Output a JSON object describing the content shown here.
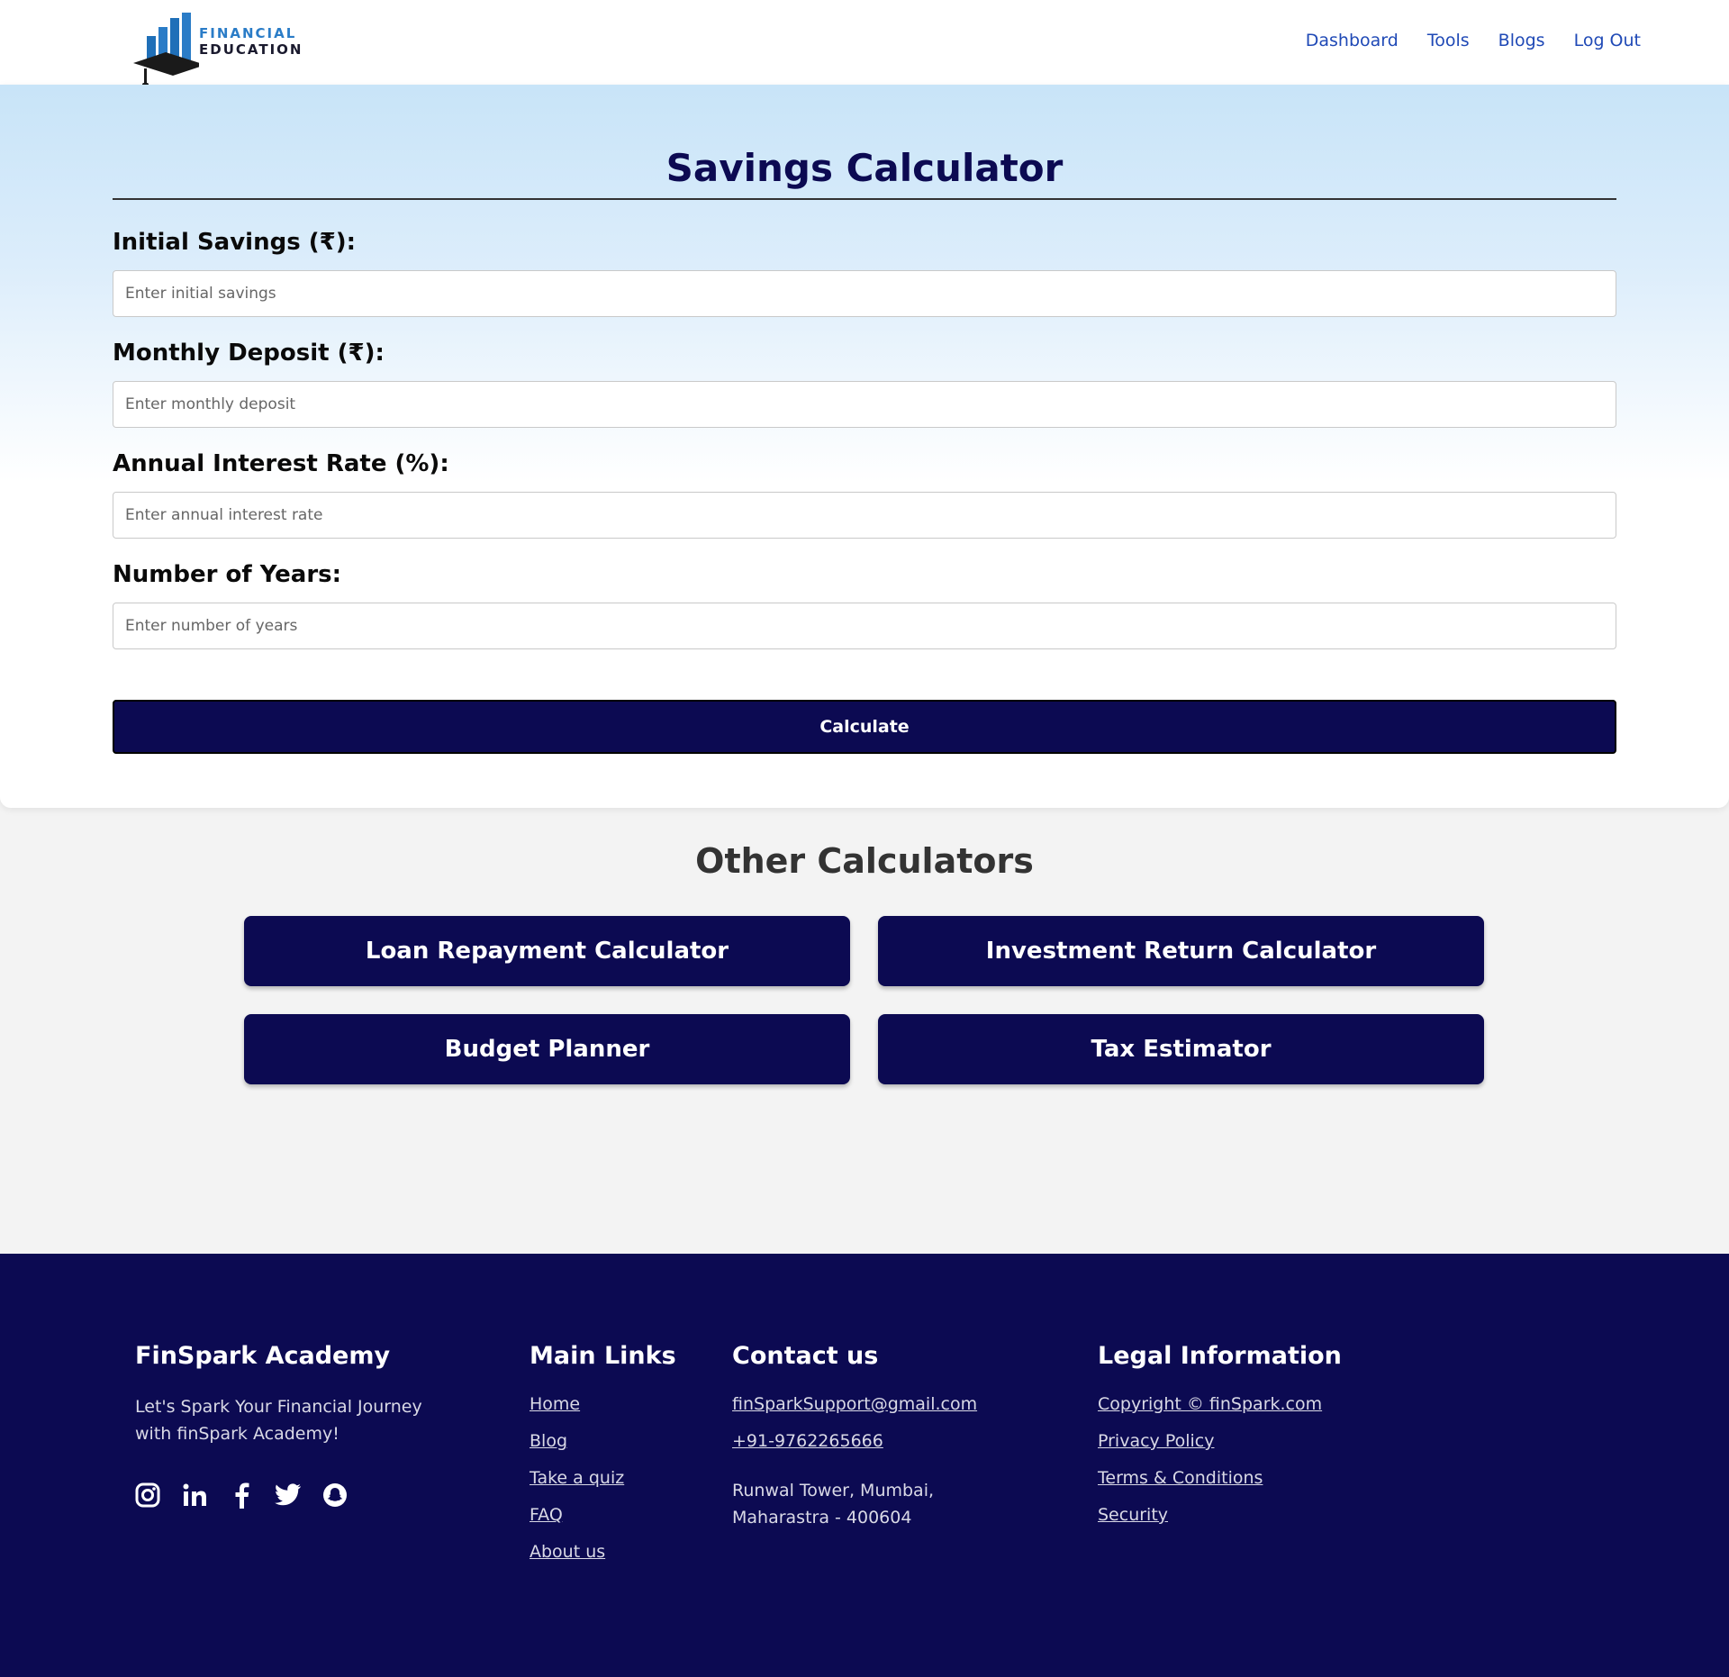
{
  "header": {
    "logo_line1": "FINANCIAL",
    "logo_line2": "EDUCATION",
    "nav": [
      "Dashboard",
      "Tools",
      "Blogs",
      "Log Out"
    ]
  },
  "calculator": {
    "title": "Savings Calculator",
    "fields": [
      {
        "label": "Initial Savings (₹):",
        "placeholder": "Enter initial savings",
        "value": ""
      },
      {
        "label": "Monthly Deposit (₹):",
        "placeholder": "Enter monthly deposit",
        "value": ""
      },
      {
        "label": "Annual Interest Rate (%):",
        "placeholder": "Enter annual interest rate",
        "value": ""
      },
      {
        "label": "Number of Years:",
        "placeholder": "Enter number of years",
        "value": ""
      }
    ],
    "button": "Calculate"
  },
  "other": {
    "title": "Other Calculators",
    "buttons": [
      "Loan Repayment Calculator",
      "Investment Return Calculator",
      "Budget Planner",
      "Tax Estimator"
    ]
  },
  "footer": {
    "brand": {
      "title": "FinSpark Academy",
      "tagline": "Let's Spark Your Financial Journey with finSpark Academy!"
    },
    "socials": [
      "instagram-icon",
      "linkedin-icon",
      "facebook-icon",
      "twitter-icon",
      "snapchat-icon"
    ],
    "main_links": {
      "title": "Main Links",
      "items": [
        "Home",
        "Blog",
        "Take a quiz",
        "FAQ",
        "About us"
      ]
    },
    "contact": {
      "title": "Contact us",
      "email": "finSparkSupport@gmail.com",
      "phone": "+91-9762265666",
      "address_line1": "Runwal Tower, Mumbai,",
      "address_line2": "Maharastra - 400604"
    },
    "legal": {
      "title": "Legal Information",
      "items": [
        "Copyright © finSpark.com",
        "Privacy Policy",
        "Terms & Conditions",
        "Security"
      ]
    }
  },
  "colors": {
    "brand_navy": "#0c0a52",
    "nav_link": "#1f49b6",
    "logo_blue": "#2a7cc7"
  }
}
